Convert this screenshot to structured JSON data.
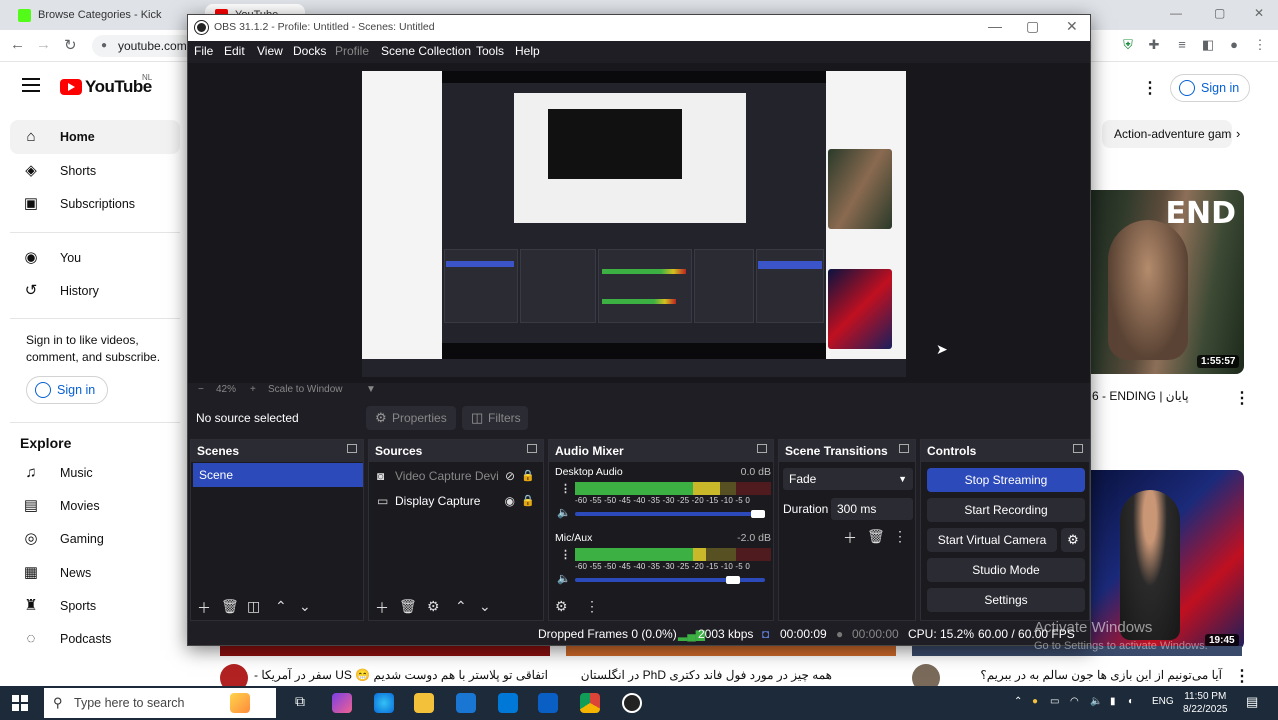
{
  "browser": {
    "tabs": [
      {
        "label": "Browse Categories - Kick Stream"
      },
      {
        "label": "YouTube"
      }
    ],
    "address": "youtube.com"
  },
  "youtube": {
    "logo_text": "YouTube",
    "country_code": "NL",
    "sidebar": {
      "items": [
        {
          "label": "Home",
          "icon": "home-icon"
        },
        {
          "label": "Shorts",
          "icon": "shorts-icon"
        },
        {
          "label": "Subscriptions",
          "icon": "subscriptions-icon"
        },
        {
          "label": "You",
          "icon": "you-icon"
        },
        {
          "label": "History",
          "icon": "history-icon"
        }
      ],
      "signin_prompt": "Sign in to like videos, comment, and subscribe.",
      "signin_label": "Sign in",
      "explore_heading": "Explore",
      "explore_items": [
        {
          "label": "Music",
          "icon": "music-icon"
        },
        {
          "label": "Movies",
          "icon": "movies-icon"
        },
        {
          "label": "Gaming",
          "icon": "gaming-icon"
        },
        {
          "label": "News",
          "icon": "news-icon"
        },
        {
          "label": "Sports",
          "icon": "sports-icon"
        },
        {
          "label": "Podcasts",
          "icon": "podcasts-icon"
        }
      ]
    },
    "header_signin": "Sign in",
    "chip": "Action-adventure games",
    "videos": [
      {
        "thumb_text": "END",
        "duration": "1:55:57",
        "title": "6 - ENDING | پایان"
      },
      {
        "duration": "19:45",
        "title": "آیا می‌تونیم از این بازی ها جون سالم به در ببریم؟"
      }
    ],
    "bottom_row": [
      {
        "title": "اتفاقی تو پلاستر با هم دوست شدیم 😁 US سفر در آمریکا -"
      },
      {
        "title": "همه چیز در مورد فول فاند دکتری PhD در انگلستان"
      }
    ]
  },
  "obs": {
    "title": "OBS 31.1.2 - Profile: Untitled - Scenes: Untitled",
    "menu": [
      "File",
      "Edit",
      "View",
      "Docks",
      "Profile",
      "Scene Collection",
      "Tools",
      "Help"
    ],
    "zoom": "42%",
    "scale_label": "Scale to Window",
    "no_source": "No source selected",
    "properties_label": "Properties",
    "filters_label": "Filters",
    "docks": {
      "scenes": {
        "title": "Scenes",
        "items": [
          "Scene"
        ]
      },
      "sources": {
        "title": "Sources",
        "items": [
          "Video Capture Devi",
          "Display Capture"
        ]
      },
      "mixer": {
        "title": "Audio Mixer",
        "channels": [
          {
            "name": "Desktop Audio",
            "db": "0.0 dB",
            "level": 0.74,
            "volume": 1.0
          },
          {
            "name": "Mic/Aux",
            "db": "-2.0 dB",
            "level": 0.67,
            "volume": 0.87
          }
        ],
        "ticks": "-60 -55 -50 -45 -40 -35 -30 -25 -20 -15 -10 -5 0"
      },
      "transitions": {
        "title": "Scene Transitions",
        "selected": "Fade",
        "duration_label": "Duration",
        "duration_value": "300 ms"
      },
      "controls": {
        "title": "Controls",
        "buttons": [
          "Stop Streaming",
          "Start Recording",
          "Start Virtual Camera",
          "Studio Mode",
          "Settings"
        ]
      }
    },
    "status": {
      "dropped": "Dropped Frames 0 (0.0%)",
      "bitrate": "2003 kbps",
      "stream_time": "00:00:09",
      "record_time": "00:00:00",
      "cpu": "CPU: 15.2%",
      "fps": "60.00 / 60.00 FPS"
    }
  },
  "windows": {
    "activate_title": "Activate Windows",
    "activate_sub": "Go to Settings to activate Windows.",
    "search_placeholder": "Type here to search",
    "lang": "ENG",
    "time": "11:50 PM",
    "date": "8/22/2025"
  },
  "colors": {
    "obs_accent": "#2d4aba",
    "youtube_red": "#ff0000",
    "link_blue": "#065fd4"
  }
}
